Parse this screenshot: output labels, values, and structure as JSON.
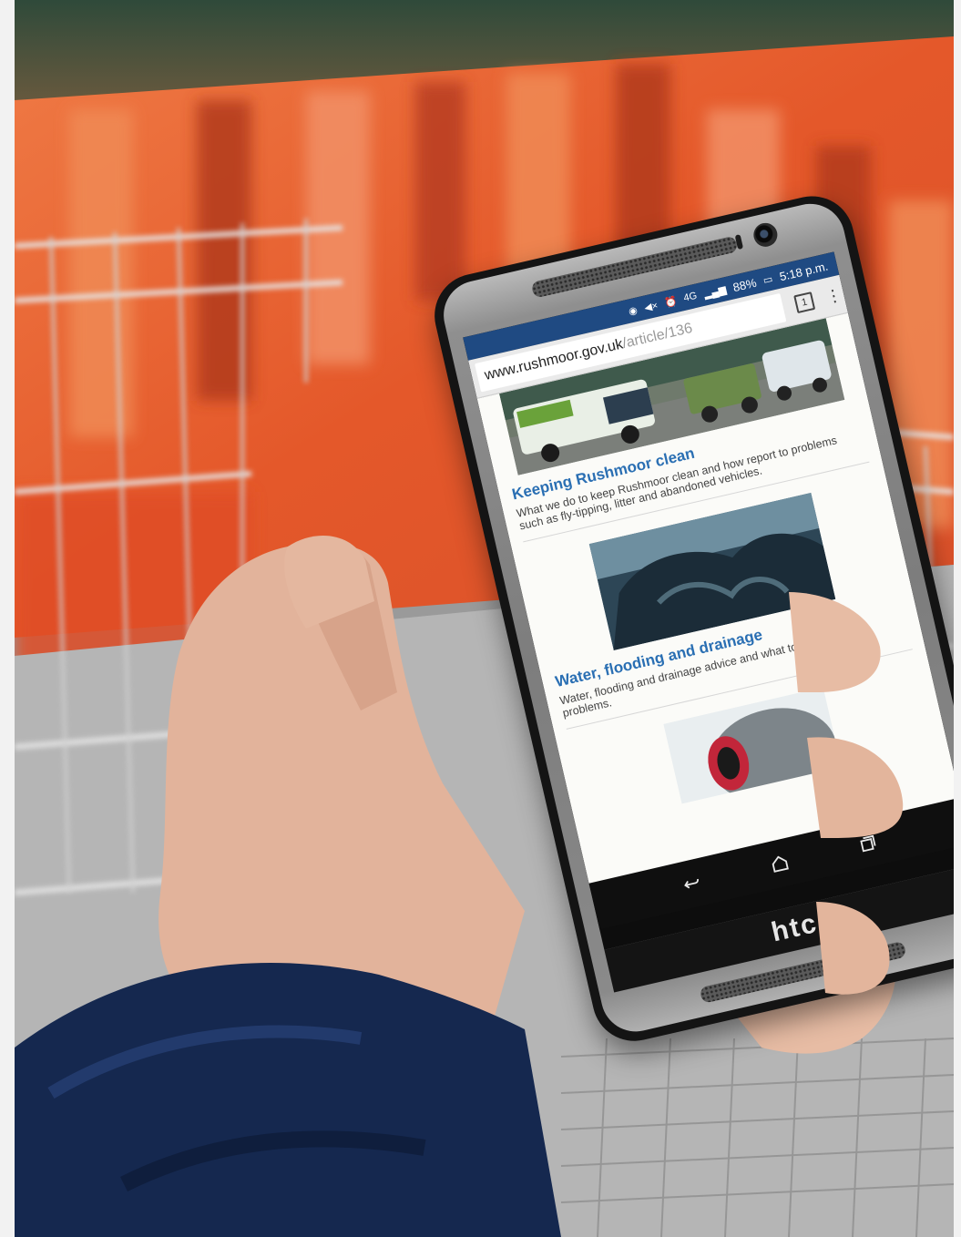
{
  "photo": {
    "subject": "hand-holding-phone",
    "colors": {
      "trolley_orange": "#e8612c",
      "trolley_metal": "#c8c8c8",
      "sleeve_navy": "#15284f",
      "skin": "#e4b9a0",
      "chrome_blue": "#1f4a82",
      "link_blue": "#2a6fb3"
    }
  },
  "phone": {
    "brand": "htc",
    "status_bar": {
      "icons": [
        "eye-icon",
        "mute-icon",
        "alarm-icon",
        "network-4g-icon",
        "signal-icon"
      ],
      "network": "4G",
      "battery": "88%",
      "time": "5:18 p.m."
    },
    "browser": {
      "url_host": "www.rushmoor.gov.uk",
      "url_path": "/article/136",
      "tab_count": "1",
      "menu_icon": "overflow-menu-icon"
    },
    "articles": [
      {
        "title": "Keeping Rushmoor clean",
        "description": "What we do to keep Rushmoor clean and how report to problems such as fly-tipping, litter and abandoned vehicles.",
        "image": "street-cleaning-vehicles"
      },
      {
        "title": "Water, flooding and drainage",
        "description": "Water, flooding and drainage advice and what to do if you have problems.",
        "image": "flood-water-reflection"
      },
      {
        "title": "",
        "description": "",
        "image": "worker-ear-defenders"
      }
    ],
    "nav_icons": [
      "back-icon",
      "home-icon",
      "recents-icon"
    ]
  }
}
